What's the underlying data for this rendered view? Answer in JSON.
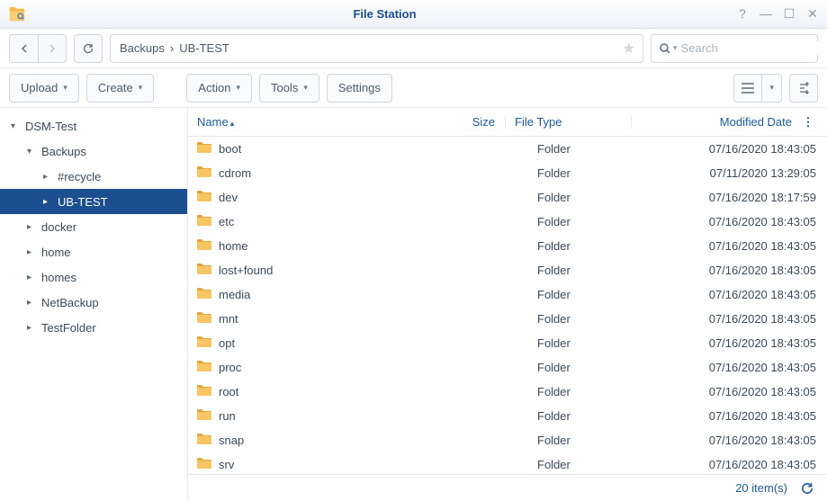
{
  "app": {
    "title": "File Station"
  },
  "breadcrumb": [
    "Backups",
    "UB-TEST"
  ],
  "search": {
    "placeholder": "Search"
  },
  "toolbar": {
    "upload": "Upload",
    "create": "Create",
    "action": "Action",
    "tools": "Tools",
    "settings": "Settings"
  },
  "tree": [
    {
      "label": "DSM-Test",
      "depth": 0,
      "expanded": true,
      "hasChildren": true
    },
    {
      "label": "Backups",
      "depth": 1,
      "expanded": true,
      "hasChildren": true
    },
    {
      "label": "#recycle",
      "depth": 2,
      "expanded": false,
      "hasChildren": true
    },
    {
      "label": "UB-TEST",
      "depth": 2,
      "expanded": false,
      "hasChildren": true,
      "selected": true
    },
    {
      "label": "docker",
      "depth": 1,
      "expanded": false,
      "hasChildren": true
    },
    {
      "label": "home",
      "depth": 1,
      "expanded": false,
      "hasChildren": true
    },
    {
      "label": "homes",
      "depth": 1,
      "expanded": false,
      "hasChildren": true
    },
    {
      "label": "NetBackup",
      "depth": 1,
      "expanded": false,
      "hasChildren": true
    },
    {
      "label": "TestFolder",
      "depth": 1,
      "expanded": false,
      "hasChildren": true
    }
  ],
  "columns": {
    "name": "Name",
    "size": "Size",
    "type": "File Type",
    "date": "Modified Date"
  },
  "files": [
    {
      "name": "boot",
      "size": "",
      "type": "Folder",
      "date": "07/16/2020 18:43:05"
    },
    {
      "name": "cdrom",
      "size": "",
      "type": "Folder",
      "date": "07/11/2020 13:29:05"
    },
    {
      "name": "dev",
      "size": "",
      "type": "Folder",
      "date": "07/16/2020 18:17:59"
    },
    {
      "name": "etc",
      "size": "",
      "type": "Folder",
      "date": "07/16/2020 18:43:05"
    },
    {
      "name": "home",
      "size": "",
      "type": "Folder",
      "date": "07/16/2020 18:43:05"
    },
    {
      "name": "lost+found",
      "size": "",
      "type": "Folder",
      "date": "07/16/2020 18:43:05"
    },
    {
      "name": "media",
      "size": "",
      "type": "Folder",
      "date": "07/16/2020 18:43:05"
    },
    {
      "name": "mnt",
      "size": "",
      "type": "Folder",
      "date": "07/16/2020 18:43:05"
    },
    {
      "name": "opt",
      "size": "",
      "type": "Folder",
      "date": "07/16/2020 18:43:05"
    },
    {
      "name": "proc",
      "size": "",
      "type": "Folder",
      "date": "07/16/2020 18:43:05"
    },
    {
      "name": "root",
      "size": "",
      "type": "Folder",
      "date": "07/16/2020 18:43:05"
    },
    {
      "name": "run",
      "size": "",
      "type": "Folder",
      "date": "07/16/2020 18:43:05"
    },
    {
      "name": "snap",
      "size": "",
      "type": "Folder",
      "date": "07/16/2020 18:43:05"
    },
    {
      "name": "srv",
      "size": "",
      "type": "Folder",
      "date": "07/16/2020 18:43:05"
    }
  ],
  "footer": {
    "count": "20 item(s)"
  }
}
